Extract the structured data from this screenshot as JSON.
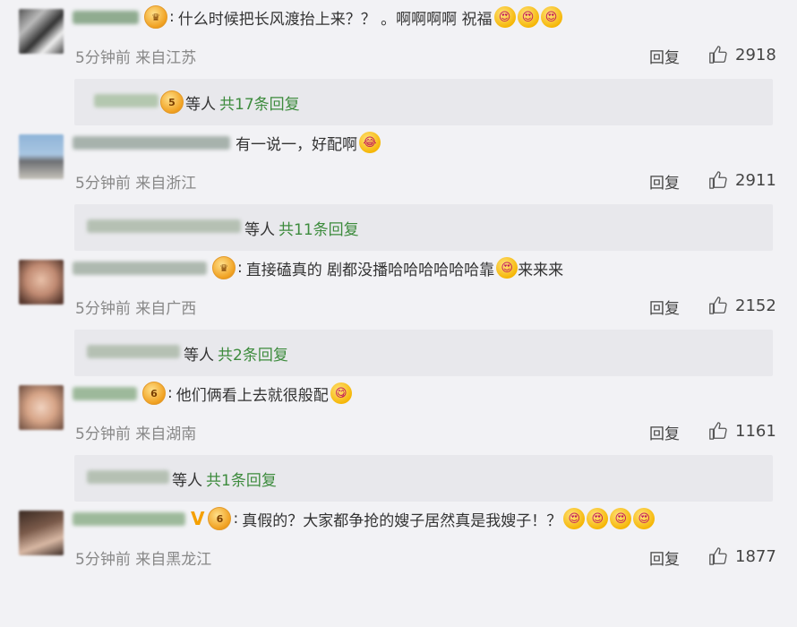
{
  "labels": {
    "reply": "回复",
    "etc": "等人"
  },
  "comments": [
    {
      "text": "什么时候把长风渡抬上来？？ 。啊啊啊啊 祝福",
      "time": "5分钟前 来自江苏",
      "likes": "2918",
      "replies_label": "共17条回复",
      "emojis": [
        "😍",
        "😍",
        "😍"
      ],
      "badge_text": "♛",
      "reply_badge_text": "5"
    },
    {
      "text": "有一说一，好配啊",
      "time": "5分钟前 来自浙江",
      "likes": "2911",
      "replies_label": "共11条回复",
      "emojis": [
        "😂"
      ]
    },
    {
      "text": "直接磕真的 剧都没播哈哈哈哈哈哈靠",
      "tail": "来来来",
      "time": "5分钟前 来自广西",
      "likes": "2152",
      "replies_label": "共2条回复",
      "emojis": [
        "😍"
      ],
      "badge_text": "♛"
    },
    {
      "text": "他们俩看上去就很般配",
      "time": "5分钟前 来自湖南",
      "likes": "1161",
      "replies_label": "共1条回复",
      "emojis": [
        "😋"
      ],
      "badge_text": "6"
    },
    {
      "text": "真假的？大家都争抢的嫂子居然真是我嫂子！？",
      "time": "5分钟前 来自黑龙江",
      "likes": "1877",
      "emojis": [
        "😍",
        "😍",
        "😍",
        "😍"
      ],
      "badge_text": "6",
      "vmark": "V"
    }
  ],
  "colors": {
    "background": "#f2f2f5",
    "reply_box": "#e8e8ec",
    "reply_count": "#3d8b3d",
    "meta_text": "#888888"
  }
}
